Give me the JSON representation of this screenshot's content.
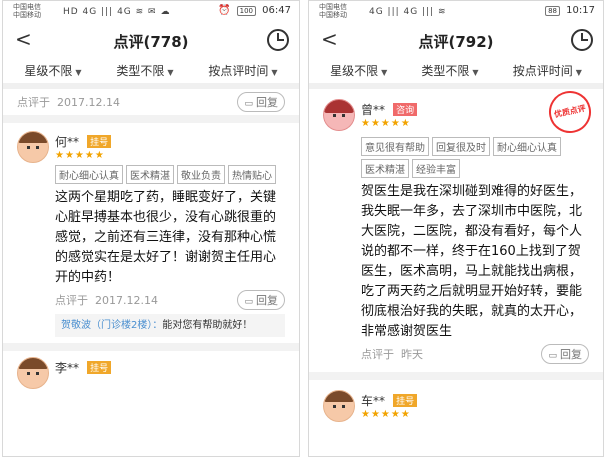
{
  "left": {
    "status": {
      "carrier1": "中国电信",
      "carrier2": "中国移动",
      "icons": "HD 4G ||| 4G ≋ ✉ ☁",
      "battery": "100",
      "time": "06:47"
    },
    "title": "点评(778)",
    "filters": [
      "星级不限",
      "类型不限",
      "按点评时间"
    ],
    "top_meta": {
      "date_label": "点评于",
      "date": "2017.12.14",
      "reply": "回复"
    },
    "review": {
      "name": "何**",
      "tag": "挂号",
      "stars": "★★★★★",
      "chips": [
        "耐心细心认真",
        "医术精湛",
        "敬业负责",
        "热情贴心"
      ],
      "text": "这两个星期吃了药，睡眠变好了，关键心脏早搏基本也很少，没有心跳很重的感觉，之前还有三连律，没有那种心慌的感觉实在是太好了！谢谢贺主任用心开的中药！",
      "date_label": "点评于",
      "date": "2017.12.14",
      "reply": "回复",
      "doctor_reply_who": "贺敬波（门诊楼2楼）：",
      "doctor_reply_text": "能对您有帮助就好！"
    },
    "next_review": {
      "name": "李**",
      "tag": "挂号"
    }
  },
  "right": {
    "status": {
      "carrier1": "中国电信",
      "carrier2": "中国移动",
      "icons": "4G ||| 4G ||| ≋",
      "battery": "88",
      "time": "10:17"
    },
    "title": "点评(792)",
    "filters": [
      "星级不限",
      "类型不限",
      "按点评时间"
    ],
    "review": {
      "name": "曾**",
      "tag": "咨询",
      "stars": "★★★★★",
      "seal": "优质点评",
      "chips": [
        "意见很有帮助",
        "回复很及时",
        "耐心细心认真",
        "医术精湛",
        "经验丰富"
      ],
      "text": "贺医生是我在深圳碰到难得的好医生，我失眠一年多，去了深圳市中医院，北大医院，二医院，都没有看好，每个人说的都不一样，终于在160上找到了贺医生，医术高明，马上就能找出病根，吃了两天药之后就明显开始好转，要能彻底根治好我的失眠，就真的太开心，非常感谢贺医生",
      "date_label": "点评于",
      "date": "昨天",
      "reply": "回复"
    },
    "next_review": {
      "name": "车**",
      "tag": "挂号",
      "stars": "★★★★★"
    }
  }
}
